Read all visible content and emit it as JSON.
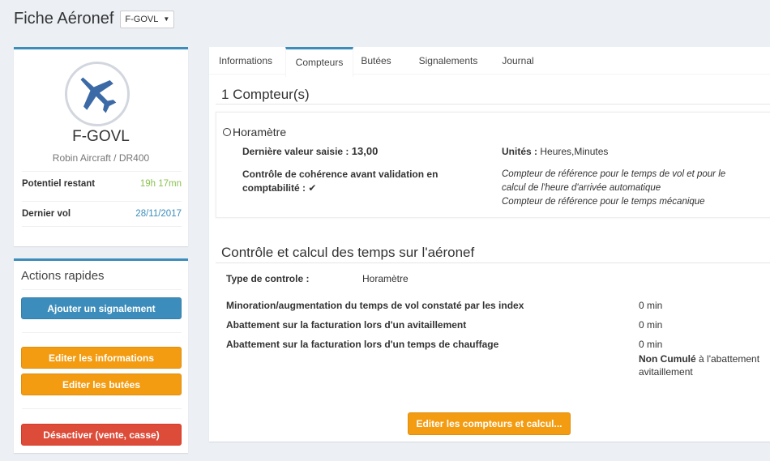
{
  "header": {
    "title": "Fiche Aéronef",
    "select_value": "F-GOVL"
  },
  "profile": {
    "registration": "F-GOVL",
    "model": "Robin Aircraft / DR400",
    "rows": [
      {
        "label": "Potentiel restant",
        "value": "19h 17mn"
      },
      {
        "label": "Dernier vol",
        "value": "28/11/2017"
      }
    ]
  },
  "actions": {
    "title": "Actions rapides",
    "add_report": "Ajouter un signalement",
    "edit_info": "Editer les informations",
    "edit_limits": "Editer les butées",
    "deactivate": "Désactiver (vente, casse)"
  },
  "tabs": [
    "Informations",
    "Compteurs",
    "Butées",
    "Signalements",
    "Journal"
  ],
  "counters": {
    "title": "1 Compteur(s)",
    "name": "Horamètre",
    "last_value_label": "Dernière valeur saisie :",
    "last_value": "13,00",
    "consistency_label": "Contrôle de cohérence avant validation en comptabilité :",
    "consistency_check": "✔",
    "units_label": "Unités :",
    "units_value": "Heures,Minutes",
    "note1": "Compteur de référence pour le temps de vol et pour le calcul de l'heure d'arrivée automatique",
    "note2": "Compteur de référence pour le temps mécanique"
  },
  "control": {
    "title": "Contrôle et calcul des temps sur l'aéronef",
    "type_label": "Type de controle :",
    "type_value": "Horamètre",
    "rows": [
      {
        "label": "Minoration/augmentation du temps de vol constaté par les index",
        "value": "0 min"
      },
      {
        "label": "Abattement sur la facturation lors d'un avitaillement",
        "value": "0 min"
      },
      {
        "label": "Abattement sur la facturation lors d'un temps de chauffage",
        "value": "0 min"
      }
    ],
    "non_cumul_bold": "Non Cumulé",
    "non_cumul_rest": "à l'abattement avitaillement",
    "edit_button": "Editer les compteurs et calcul..."
  },
  "colors": {
    "primary": "#3c8dbc",
    "warning": "#f39c12",
    "danger": "#dd4b39",
    "success": "#8cc152"
  }
}
